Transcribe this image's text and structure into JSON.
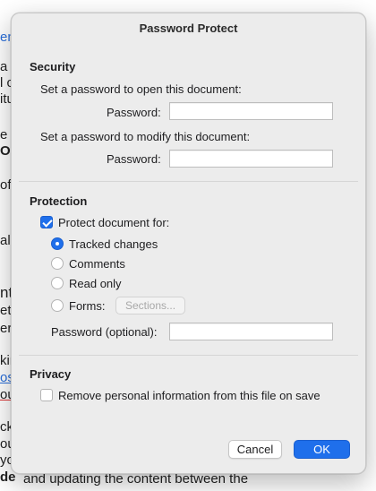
{
  "background_fragments": [
    {
      "text": "en",
      "style": "blue"
    },
    {
      "text": "a"
    },
    {
      "text": "l c"
    },
    {
      "text": "itu"
    },
    {
      "text": "e c"
    },
    {
      "text": "Or",
      "style": "bold"
    },
    {
      "text": "of"
    },
    {
      "text": "al"
    },
    {
      "text": "nte"
    },
    {
      "text": "ets"
    },
    {
      "text": "ern"
    },
    {
      "text": "kin"
    },
    {
      "text": "os",
      "style": "link"
    },
    {
      "text": "ou",
      "style": "underline"
    },
    {
      "text": "ck"
    },
    {
      "text": "ou"
    },
    {
      "text": "yo"
    },
    {
      "text": "de",
      "style": "bold"
    },
    {
      "text": "and updating the content between the"
    }
  ],
  "dialog": {
    "title": "Password Protect",
    "security": {
      "title": "Security",
      "open_caption": "Set a password to open this document:",
      "open_label": "Password:",
      "open_value": "",
      "modify_caption": "Set a password to modify this document:",
      "modify_label": "Password:",
      "modify_value": ""
    },
    "protection": {
      "title": "Protection",
      "protect_label": "Protect document for:",
      "protect_checked": true,
      "options": [
        {
          "label": "Tracked changes",
          "selected": true
        },
        {
          "label": "Comments",
          "selected": false
        },
        {
          "label": "Read only",
          "selected": false
        },
        {
          "label": "Forms:",
          "selected": false
        }
      ],
      "sections_label": "Sections...",
      "optional_label": "Password (optional):",
      "optional_value": ""
    },
    "privacy": {
      "title": "Privacy",
      "remove_label": "Remove personal information from this file on save",
      "remove_checked": false
    },
    "buttons": {
      "cancel": "Cancel",
      "ok": "OK"
    }
  },
  "colors": {
    "accent": "#1f6feb",
    "dialog_bg": "#ececec",
    "doc_link": "#2a6fdb"
  }
}
